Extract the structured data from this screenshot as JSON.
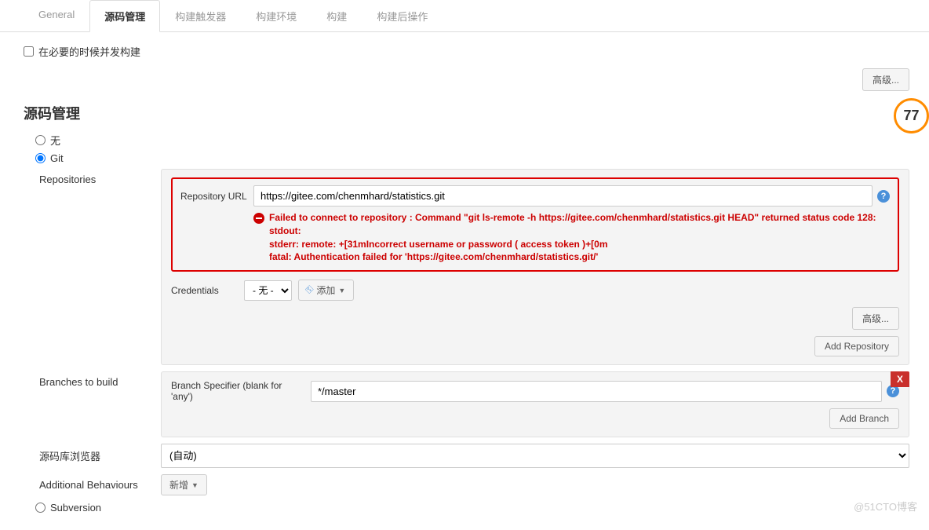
{
  "tabs": [
    {
      "label": "General"
    },
    {
      "label": "源码管理"
    },
    {
      "label": "构建触发器"
    },
    {
      "label": "构建环境"
    },
    {
      "label": "构建"
    },
    {
      "label": "构建后操作"
    }
  ],
  "concurrent_checkbox_label": "在必要的时候并发构建",
  "advanced_button": "高级...",
  "section_title": "源码管理",
  "scm_options": {
    "none": "无",
    "git": "Git",
    "subversion": "Subversion"
  },
  "repositories": {
    "label": "Repositories",
    "url_label": "Repository URL",
    "url_value": "https://gitee.com/chenmhard/statistics.git",
    "error_lines": [
      "Failed to connect to repository : Command \"git ls-remote -h https://gitee.com/chenmhard/statistics.git HEAD\" returned status code 128:",
      "stdout:",
      "stderr: remote: +[31mIncorrect username or password ( access token )+[0m",
      "fatal: Authentication failed for 'https://gitee.com/chenmhard/statistics.git/'"
    ],
    "credentials_label": "Credentials",
    "credentials_value": "- 无 -",
    "add_button": "添加",
    "advanced_button": "高级...",
    "add_repo_button": "Add Repository"
  },
  "branches": {
    "label": "Branches to build",
    "specifier_label": "Branch Specifier (blank for 'any')",
    "specifier_value": "*/master",
    "add_branch_button": "Add Branch"
  },
  "browser": {
    "label": "源码库浏览器",
    "value": "(自动)"
  },
  "behaviours": {
    "label": "Additional Behaviours",
    "button": "新增"
  },
  "score_badge": "77",
  "watermark": "@51CTO博客"
}
